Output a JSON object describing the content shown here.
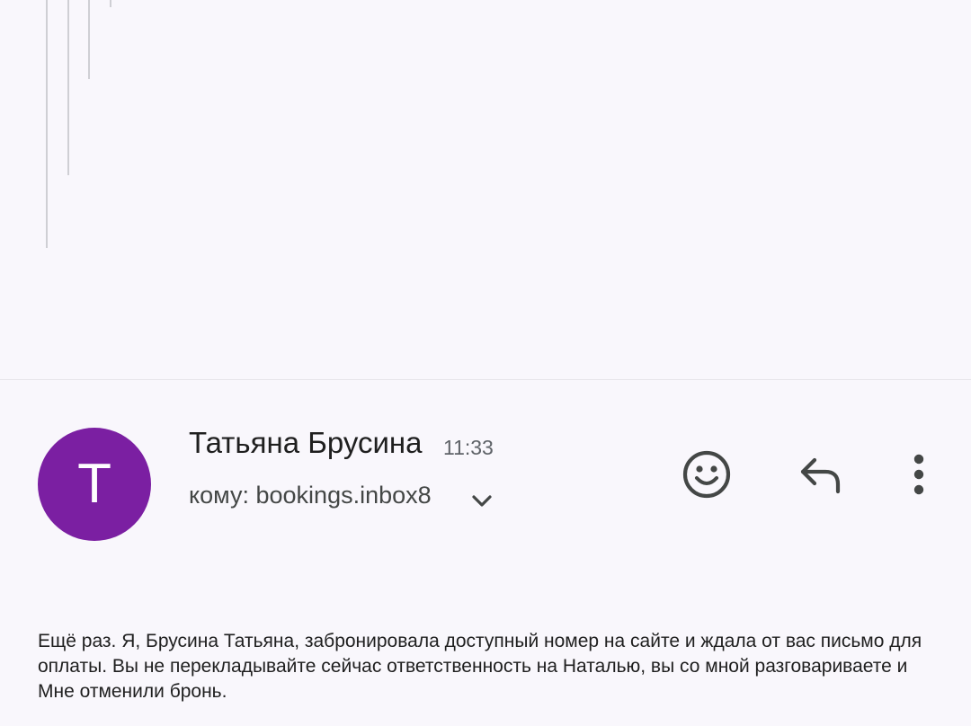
{
  "message": {
    "avatar_letter": "T",
    "avatar_color": "#7b1fa2",
    "sender_name": "Татьяна Брусина",
    "time": "11:33",
    "recipient": "кому: bookings.inbox8",
    "body": "Ещё раз. Я, Брусина Татьяна, забронировала доступный номер на сайте и ждала от вас письмо для оплаты. Вы не перекладывайте сейчас ответственность на Наталью, вы со мной разговариваете и Мне отменили бронь."
  },
  "icons": {
    "recipient_toggle": "chevron-down-icon",
    "emoji": "emoji-reaction-icon",
    "reply": "reply-icon",
    "more": "more-vert-icon"
  }
}
